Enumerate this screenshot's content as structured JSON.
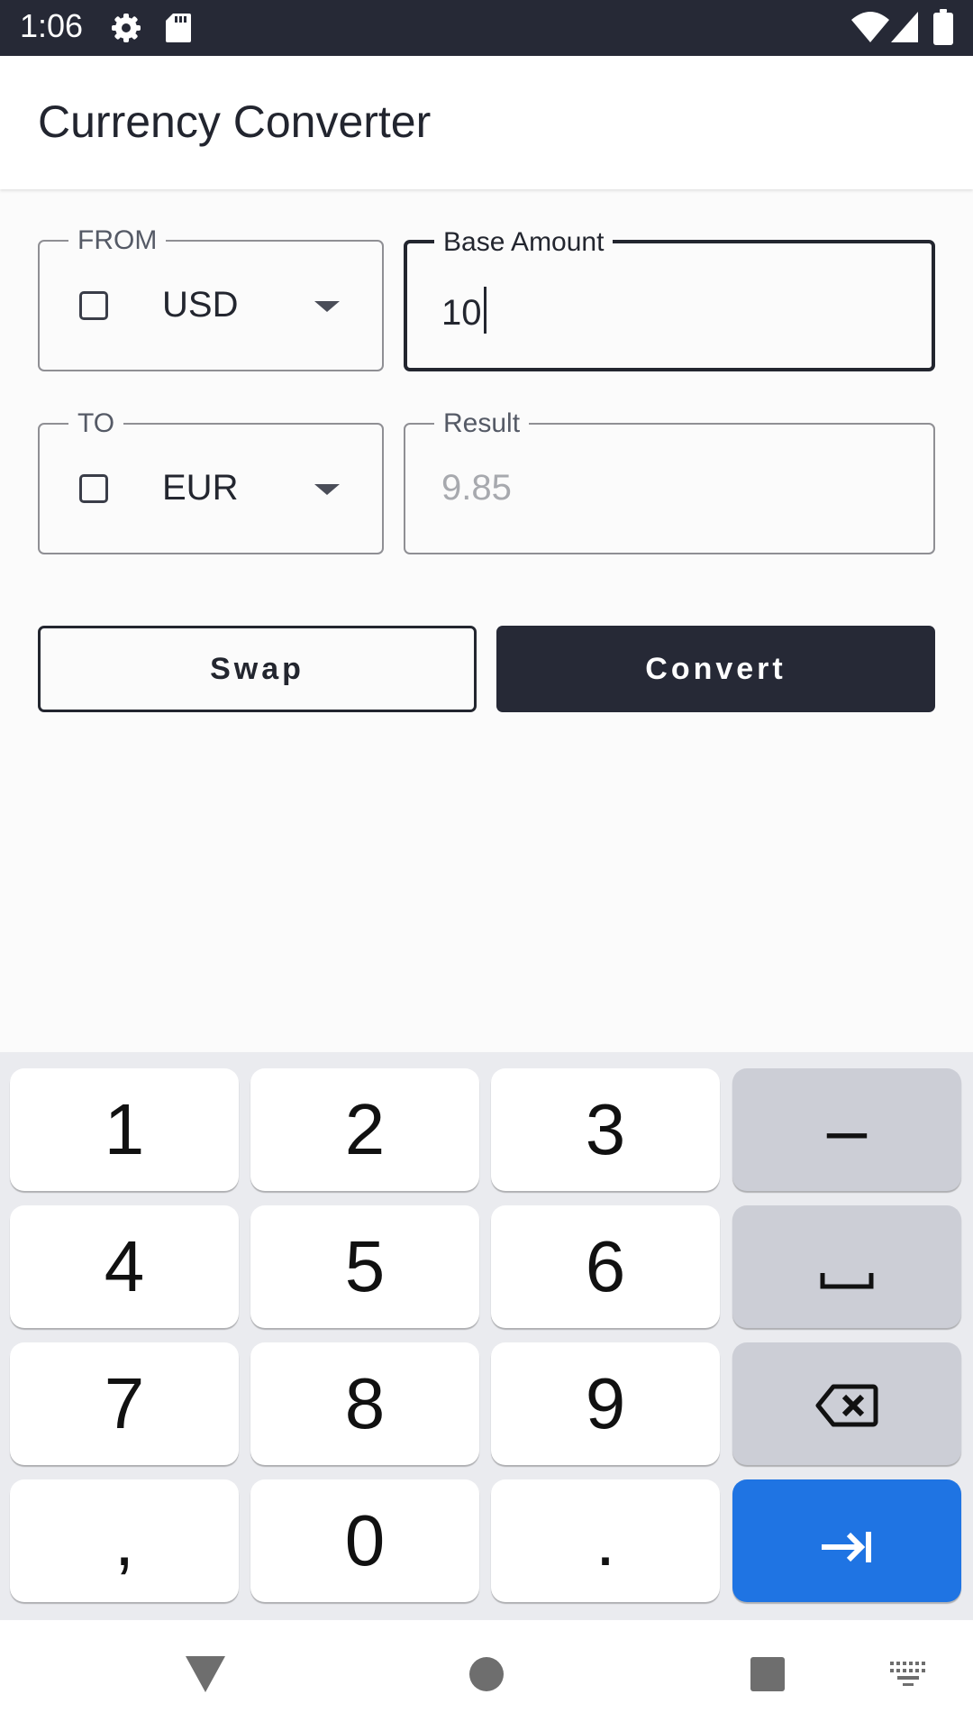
{
  "status_bar": {
    "time": "1:06",
    "icons": [
      "settings-icon",
      "sd-card-icon",
      "wifi-icon",
      "signal-icon",
      "battery-icon"
    ]
  },
  "app_bar": {
    "title": "Currency Converter"
  },
  "form": {
    "from": {
      "label": "FROM",
      "value": "USD"
    },
    "base_amount": {
      "label": "Base Amount",
      "value": "10"
    },
    "to": {
      "label": "TO",
      "value": "EUR"
    },
    "result": {
      "label": "Result",
      "value": "9.85"
    }
  },
  "buttons": {
    "swap": "Swap",
    "convert": "Convert"
  },
  "keyboard": {
    "keys": [
      "1",
      "2",
      "3",
      "–",
      "4",
      "5",
      "6",
      "7",
      "8",
      "9",
      ",",
      "0",
      "."
    ],
    "icons": [
      "space-icon",
      "backspace-icon",
      "next-field-icon"
    ]
  },
  "nav_bar": {
    "icons": [
      "back-icon",
      "home-icon",
      "recents-icon",
      "keyboard-switch-icon"
    ]
  },
  "colors": {
    "primary": "#262936",
    "accent": "#1f74e3",
    "background": "#fbfbfb",
    "keyboard_bg": "#eaebef"
  }
}
